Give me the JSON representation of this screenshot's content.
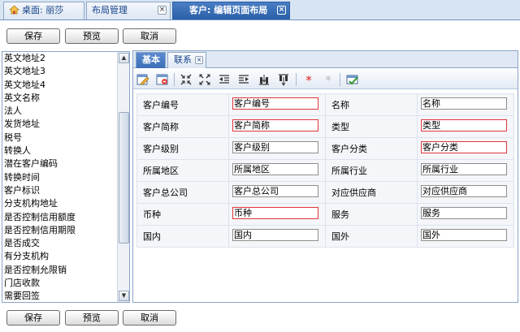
{
  "top_tabs": [
    {
      "label": "桌面: 丽莎",
      "icon": "home-icon",
      "closable": false
    },
    {
      "label": "布局管理",
      "closable": true
    },
    {
      "label": "客户: 编辑页面布局",
      "closable": true,
      "active": true
    }
  ],
  "buttons": {
    "save": "保存",
    "preview": "预览",
    "cancel": "取消"
  },
  "left_list": [
    "英文地址2",
    "英文地址3",
    "英文地址4",
    "英文名称",
    "法人",
    "发货地址",
    "税号",
    "转换人",
    "潜在客户编码",
    "转换时间",
    "客户标识",
    "分支机构地址",
    "是否控制信用额度",
    "是否控制信用期限",
    "是否成交",
    "有分支机构",
    "是否控制允限销",
    "门店收款",
    "需要回签"
  ],
  "sub_tabs": [
    {
      "label": "基本",
      "active": true
    },
    {
      "label": "联系",
      "closable": true
    }
  ],
  "toolbar_icons": [
    "edit-layout-icon",
    "delete-layout-icon",
    "collapse-icon",
    "expand-icon",
    "indent-left-icon",
    "indent-right-icon",
    "align-top-icon",
    "align-bottom-icon",
    "required-on-icon",
    "required-off-icon",
    "apply-icon"
  ],
  "form_rows": [
    [
      {
        "label": "客户编号",
        "value": "客户编号",
        "required": true
      },
      {
        "label": "名称",
        "value": "名称",
        "required": false
      }
    ],
    [
      {
        "label": "客户简称",
        "value": "客户简称",
        "required": true
      },
      {
        "label": "类型",
        "value": "类型",
        "required": true
      }
    ],
    [
      {
        "label": "客户级别",
        "value": "客户级别",
        "required": false
      },
      {
        "label": "客户分类",
        "value": "客户分类",
        "required": true
      }
    ],
    [
      {
        "label": "所属地区",
        "value": "所属地区",
        "required": false
      },
      {
        "label": "所属行业",
        "value": "所属行业",
        "required": false
      }
    ],
    [
      {
        "label": "客户总公司",
        "value": "客户总公司",
        "required": false
      },
      {
        "label": "对应供应商",
        "value": "对应供应商",
        "required": false
      }
    ],
    [
      {
        "label": "币种",
        "value": "币种",
        "required": true
      },
      {
        "label": "服务",
        "value": "服务",
        "required": false
      }
    ],
    [
      {
        "label": "国内",
        "value": "国内",
        "required": false
      },
      {
        "label": "国外",
        "value": "国外",
        "required": false
      }
    ]
  ],
  "colors": {
    "accent": "#2a5fa8",
    "required_border": "#e0363b"
  }
}
